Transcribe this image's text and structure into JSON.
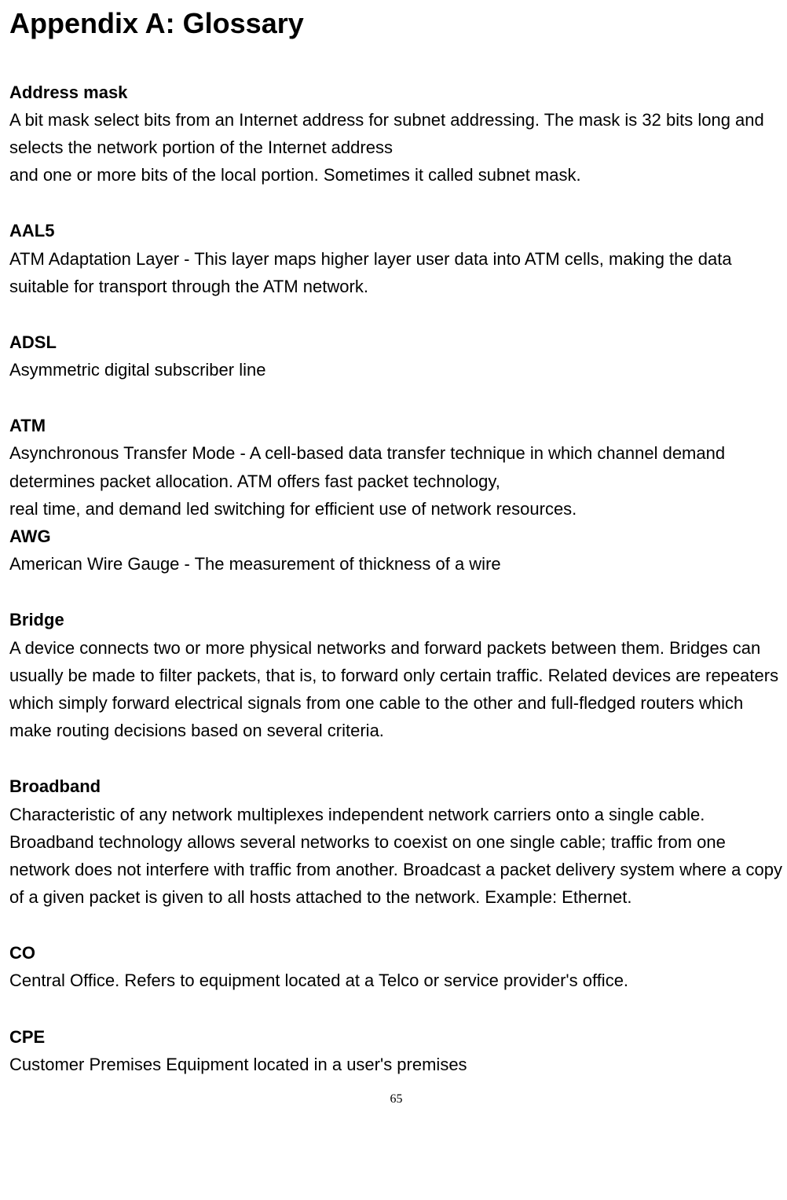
{
  "title": "Appendix A: Glossary",
  "entries": [
    {
      "term": "Address mask",
      "def": "A bit mask select bits from an Internet address for subnet addressing. The mask is 32 bits long and selects the network portion of the Internet address\nand one or more bits of the local portion. Sometimes it called subnet mask.",
      "gapAfter": true
    },
    {
      "term": "AAL5",
      "def": "ATM Adaptation Layer - This layer maps higher layer user data into ATM cells, making the data suitable for transport through the ATM network.",
      "gapAfter": true
    },
    {
      "term": "ADSL",
      "def": "Asymmetric digital subscriber line",
      "gapAfter": true
    },
    {
      "term": "ATM",
      "def": "Asynchronous Transfer Mode - A cell-based data transfer technique in which channel demand determines packet allocation. ATM offers fast packet technology,\nreal time, and demand led switching for efficient use of network resources.",
      "gapAfter": false
    },
    {
      "term": "AWG",
      "def": "American Wire Gauge - The measurement of thickness of a wire",
      "gapAfter": true
    },
    {
      "term": "Bridge",
      "def": "A device connects two or more physical networks and forward packets between them. Bridges can usually be made to filter packets, that is, to forward only certain traffic. Related devices are repeaters which simply forward electrical signals from one cable to the other and full-fledged routers which make routing decisions based on several criteria.",
      "gapAfter": true
    },
    {
      "term": "Broadband",
      "def": "Characteristic of any network multiplexes independent network carriers onto a single cable. Broadband technology allows several networks to coexist on one single cable; traffic from one network does not interfere with traffic from another. Broadcast a packet delivery system where a copy of a given packet is given to all hosts attached to the network. Example: Ethernet.",
      "gapAfter": true
    },
    {
      "term": "CO",
      "def": "Central Office. Refers to equipment located at a Telco or service provider's office.",
      "gapAfter": true
    },
    {
      "term": "CPE",
      "def": "Customer Premises Equipment located in a user's premises",
      "gapAfter": false
    }
  ],
  "pageNumber": "65"
}
